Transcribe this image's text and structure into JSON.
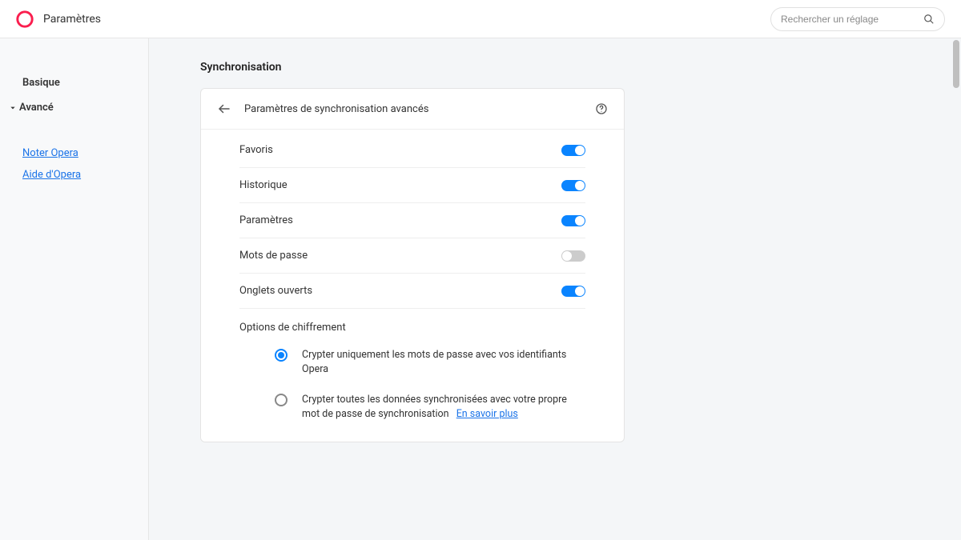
{
  "header": {
    "title": "Paramètres",
    "search_placeholder": "Rechercher un réglage"
  },
  "sidebar": {
    "basic": "Basique",
    "advanced": "Avancé",
    "rate_link": "Noter Opera",
    "help_link": "Aide d'Opera"
  },
  "page": {
    "section_title": "Synchronisation",
    "card_title": "Paramètres de synchronisation avancés",
    "rows": {
      "favorites": {
        "label": "Favoris",
        "on": true
      },
      "history": {
        "label": "Historique",
        "on": true
      },
      "settings": {
        "label": "Paramètres",
        "on": true
      },
      "passwords": {
        "label": "Mots de passe",
        "on": false
      },
      "open_tabs": {
        "label": "Onglets ouverts",
        "on": true
      }
    },
    "encryption": {
      "title": "Options de chiffrement",
      "option1": "Crypter uniquement les mots de passe avec vos identifiants Opera",
      "option2": "Crypter toutes les données synchronisées avec votre propre mot de passe de synchronisation",
      "learn_more": "En savoir plus",
      "selected": 1
    }
  },
  "colors": {
    "accent": "#0a84ff",
    "link": "#1a73e8"
  }
}
